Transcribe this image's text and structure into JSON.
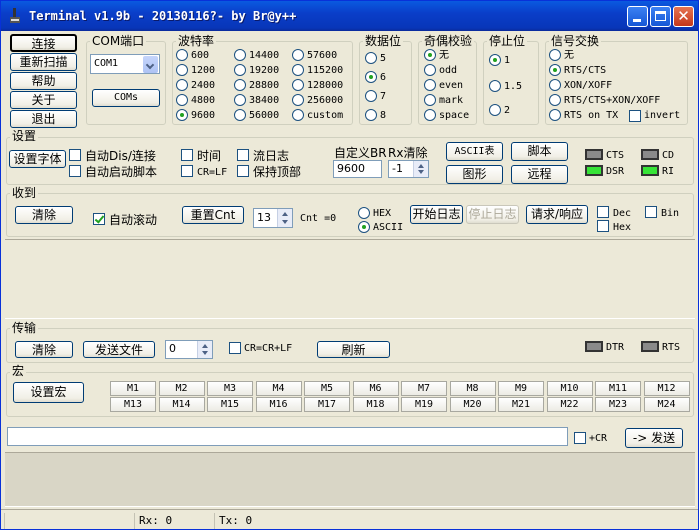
{
  "window": {
    "title": "Terminal v1.9b - 20130116?- by Br@y++"
  },
  "left_buttons": {
    "connect": "连接",
    "rescan": "重新扫描",
    "help": "帮助",
    "about": "关于",
    "exit": "退出"
  },
  "com": {
    "group": "COM端口",
    "value": "COM1",
    "coms_button": "COMs"
  },
  "baud": {
    "group": "波特率",
    "options": [
      "600",
      "1200",
      "2400",
      "4800",
      "9600",
      "14400",
      "19200",
      "28800",
      "38400",
      "56000",
      "57600",
      "115200",
      "128000",
      "256000",
      "custom"
    ],
    "selected": "9600"
  },
  "databits": {
    "group": "数据位",
    "options": [
      "5",
      "6",
      "7",
      "8"
    ],
    "selected": "6"
  },
  "parity": {
    "group": "奇偶校验",
    "options": [
      "无",
      "odd",
      "even",
      "mark",
      "space"
    ],
    "selected": "无"
  },
  "stopbits": {
    "group": "停止位",
    "options": [
      "1",
      "1.5",
      "2"
    ],
    "selected": "1"
  },
  "handshake": {
    "group": "信号交换",
    "options": [
      "无",
      "RTS/CTS",
      "XON/XOFF",
      "RTS/CTS+XON/XOFF",
      "RTS on TX"
    ],
    "selected": "RTS/CTS",
    "invert": "invert"
  },
  "settings": {
    "section": "设置",
    "font_button": "设置字体",
    "auto_dis": "自动Dis/连接",
    "auto_script": "自动启动脚本",
    "time": "时间",
    "crlf": "CR=LF",
    "stream_log": "流日志",
    "keep_top": "保持顶部",
    "custom_br_label": "自定义BR",
    "custom_br_value": "9600",
    "rx_clear_label": "Rx清除",
    "rx_clear_value": "-1",
    "ascii_button": "ASCII表",
    "graph_button": "图形",
    "script_button": "脚本",
    "remote_button": "远程",
    "cts": "CTS",
    "cd": "CD",
    "dsr": "DSR",
    "ri": "RI"
  },
  "receive": {
    "section": "收到",
    "clear_button": "清除",
    "autoscroll": "自动滚动",
    "reset_cnt_button": "重置Cnt",
    "cnt_value": "13",
    "cnt_label": "Cnt =0",
    "hex": "HEX",
    "ascii": "ASCII",
    "start_log": "开始日志",
    "stop_log": "停止日志",
    "request_response": "请求/响应",
    "dec": "Dec",
    "hex_chk": "Hex",
    "bin": "Bin"
  },
  "transmit": {
    "section": "传输",
    "clear_button": "清除",
    "send_file_button": "发送文件",
    "spin_value": "0",
    "crcrlf": "CR=CR+LF",
    "refresh_button": "刷新",
    "dtr": "DTR",
    "rts": "RTS"
  },
  "macros": {
    "section": "宏",
    "set_button": "设置宏",
    "row1": [
      "M1",
      "M2",
      "M3",
      "M4",
      "M5",
      "M6",
      "M7",
      "M8",
      "M9",
      "M10",
      "M11",
      "M12"
    ],
    "row2": [
      "M13",
      "M14",
      "M15",
      "M16",
      "M17",
      "M18",
      "M19",
      "M20",
      "M21",
      "M22",
      "M23",
      "M24"
    ]
  },
  "send": {
    "input_value": "",
    "cr_label": "+CR",
    "send_button": "-> 发送"
  },
  "status": {
    "rx": "Rx: 0",
    "tx": "Tx: 0"
  }
}
